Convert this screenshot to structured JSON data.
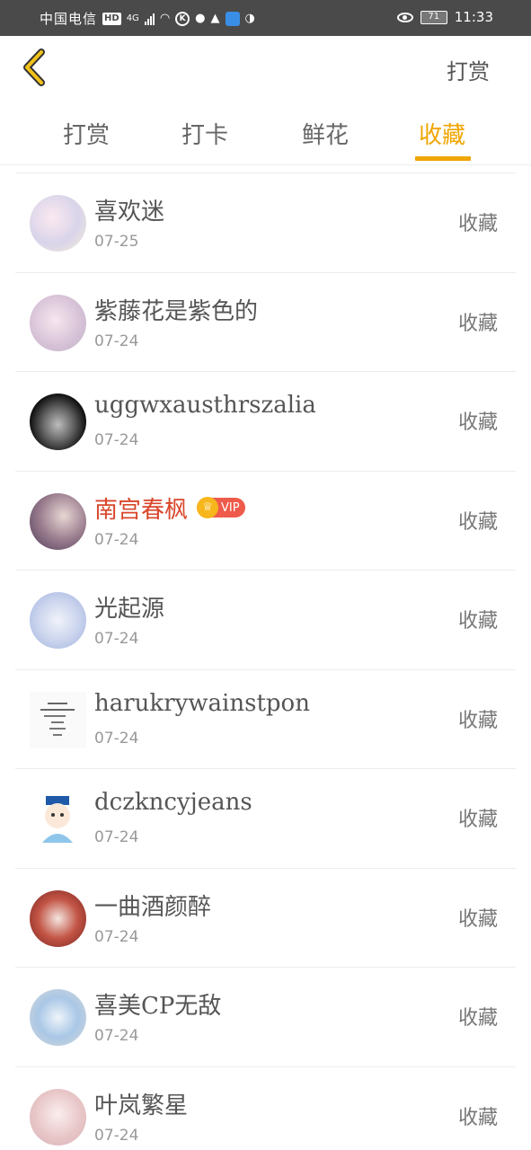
{
  "status_bar": {
    "carrier": "中国电信",
    "hd": "HD",
    "network": "4G",
    "k_icon": "K",
    "battery": "71",
    "time": "11:33"
  },
  "header": {
    "back_icon": "chevron-left-icon",
    "action_label": "打赏"
  },
  "tabs": [
    {
      "label": "打赏",
      "active": false
    },
    {
      "label": "打卡",
      "active": false
    },
    {
      "label": "鲜花",
      "active": false
    },
    {
      "label": "收藏",
      "active": true
    }
  ],
  "colors": {
    "accent": "#f0a500",
    "vip_name": "#d9472b",
    "vip_badge": "#ef5b4a"
  },
  "records": [
    {
      "name": "喜欢迷",
      "date": "07-25",
      "type": "收藏",
      "vip": false
    },
    {
      "name": "紫藤花是紫色的",
      "date": "07-24",
      "type": "收藏",
      "vip": false
    },
    {
      "name": "uggwxausthrszalia",
      "date": "07-24",
      "type": "收藏",
      "vip": false
    },
    {
      "name": "南宫春枫",
      "date": "07-24",
      "type": "收藏",
      "vip": true,
      "vip_label": "VIP"
    },
    {
      "name": "光起源",
      "date": "07-24",
      "type": "收藏",
      "vip": false
    },
    {
      "name": "harukrywainstpon",
      "date": "07-24",
      "type": "收藏",
      "vip": false
    },
    {
      "name": "dczkncyjeans",
      "date": "07-24",
      "type": "收藏",
      "vip": false
    },
    {
      "name": "一曲酒颜醉",
      "date": "07-24",
      "type": "收藏",
      "vip": false
    },
    {
      "name": "喜美CP无敌",
      "date": "07-24",
      "type": "收藏",
      "vip": false
    },
    {
      "name": "叶岚繁星",
      "date": "07-24",
      "type": "收藏",
      "vip": false
    }
  ]
}
